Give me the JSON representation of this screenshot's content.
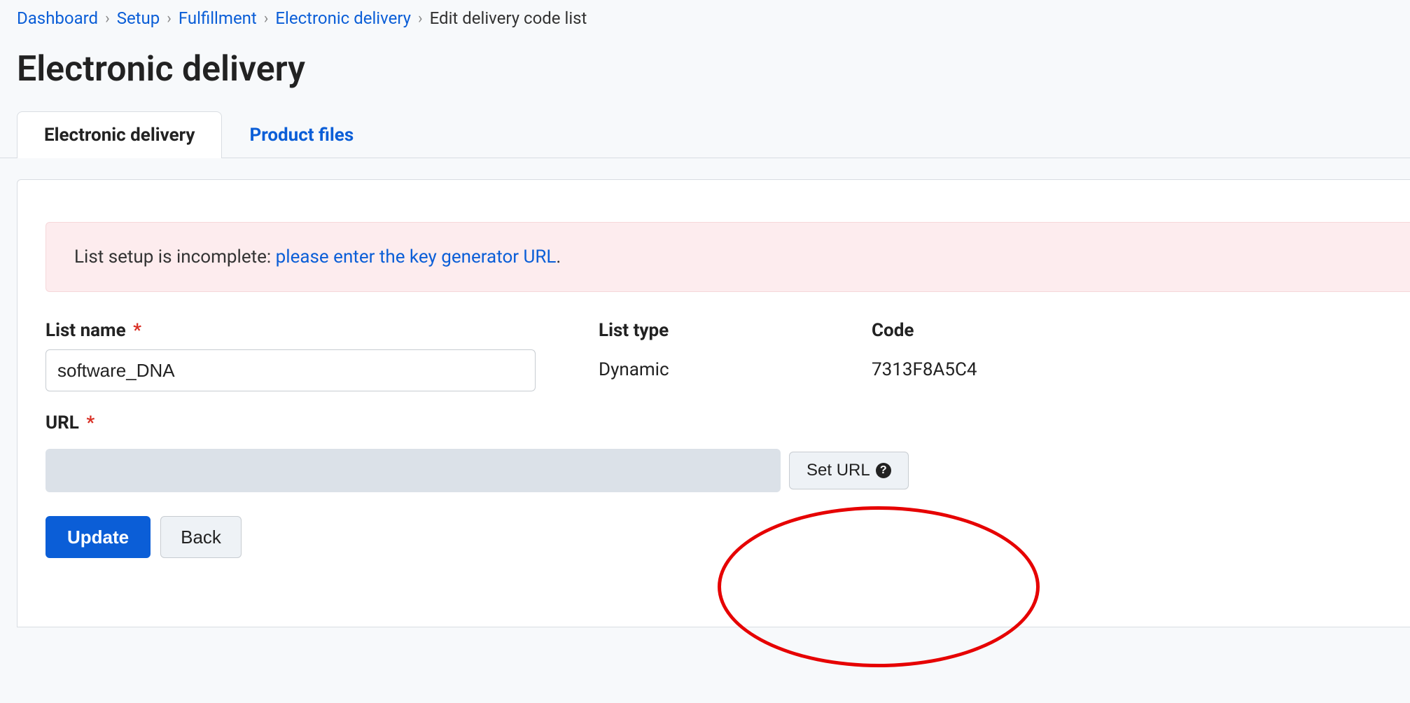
{
  "breadcrumb": {
    "items": [
      {
        "label": "Dashboard",
        "link": true
      },
      {
        "label": "Setup",
        "link": true
      },
      {
        "label": "Fulfillment",
        "link": true
      },
      {
        "label": "Electronic delivery",
        "link": true
      },
      {
        "label": "Edit delivery code list",
        "link": false
      }
    ],
    "separator": "›"
  },
  "page_title": "Electronic delivery",
  "tabs": [
    {
      "label": "Electronic delivery",
      "active": true
    },
    {
      "label": "Product files",
      "active": false
    }
  ],
  "alert": {
    "prefix": "List setup is incomplete: ",
    "link_text": "please enter the key generator URL",
    "suffix": "."
  },
  "form": {
    "list_name": {
      "label": "List name",
      "required": true,
      "value": "software_DNA"
    },
    "list_type": {
      "label": "List type",
      "value": "Dynamic"
    },
    "code": {
      "label": "Code",
      "value": "7313F8A5C4"
    },
    "url": {
      "label": "URL",
      "required": true,
      "value": ""
    },
    "set_url_button": "Set URL",
    "required_marker": "*"
  },
  "buttons": {
    "update": "Update",
    "back": "Back"
  },
  "icons": {
    "help": "?"
  }
}
